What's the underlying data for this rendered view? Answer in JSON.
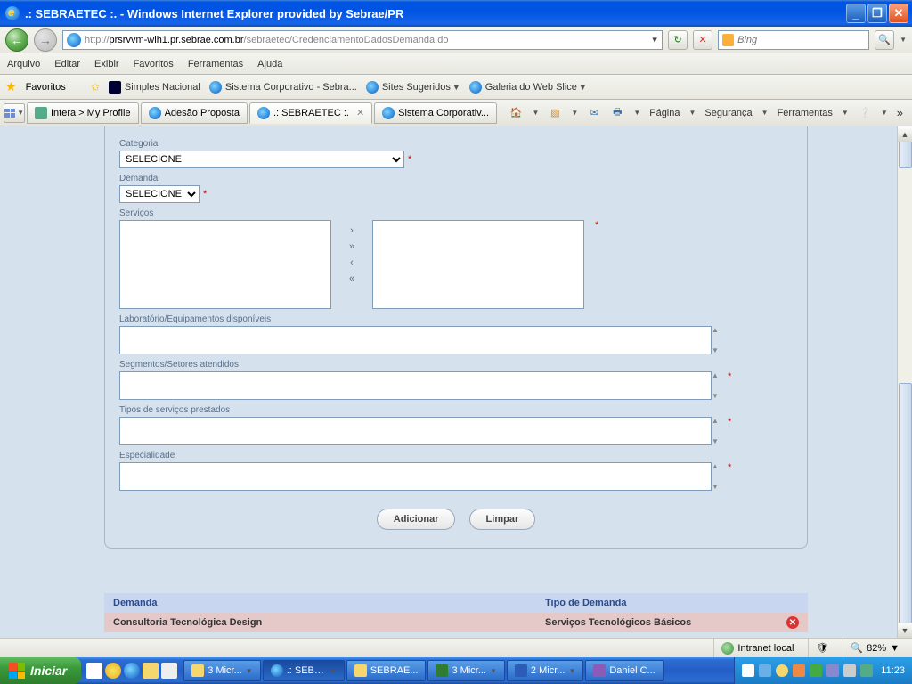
{
  "titlebar": {
    "title": ".: SEBRAETEC :. - Windows Internet Explorer provided by Sebrae/PR"
  },
  "addressbar": {
    "url_prefix": "http://",
    "url_host": "prsrvvm-wlh1.pr.sebrae.com.br",
    "url_path": "/sebraetec/CredenciamentoDadosDemanda.do",
    "search_placeholder": "Bing"
  },
  "menu": {
    "arquivo": "Arquivo",
    "editar": "Editar",
    "exibir": "Exibir",
    "favoritos": "Favoritos",
    "ferramentas": "Ferramentas",
    "ajuda": "Ajuda"
  },
  "favbar": {
    "favoritos": "Favoritos",
    "simples": "Simples Nacional",
    "sistema": "Sistema Corporativo - Sebra...",
    "sugeridos": "Sites Sugeridos",
    "webslice": "Galeria do Web Slice"
  },
  "tabs": {
    "t1": "Intera > My Profile",
    "t2": "Adesão Proposta",
    "t3": ".: SEBRAETEC :.",
    "t4": "Sistema Corporativ..."
  },
  "cmdbar": {
    "pagina": "Página",
    "seguranca": "Segurança",
    "ferramentas": "Ferramentas"
  },
  "form": {
    "categoria_label": "Categoria",
    "categoria_value": "SELECIONE",
    "demanda_label": "Demanda",
    "demanda_value": "SELECIONE",
    "servicos_label": "Serviços",
    "laboratorio_label": "Laboratório/Equipamentos disponíveis",
    "segmentos_label": "Segmentos/Setores atendidos",
    "tipos_label": "Tipos de serviços prestados",
    "especialidade_label": "Especialidade",
    "adicionar": "Adicionar",
    "limpar": "Limpar"
  },
  "table": {
    "h1": "Demanda",
    "h2": "Tipo de Demanda",
    "r1c1": "Consultoria Tecnológica Design",
    "r1c2": "Serviços Tecnológicos Básicos"
  },
  "status": {
    "zone": "Intranet local",
    "zoom": "82%"
  },
  "taskbar": {
    "iniciar": "Iniciar",
    "t1": "3 Micr...",
    "t2": ".: SEBR...",
    "t3": "SEBRAE...",
    "t4": "3 Micr...",
    "t5": "2 Micr...",
    "t6": "Daniel C...",
    "clock": "11:23"
  }
}
